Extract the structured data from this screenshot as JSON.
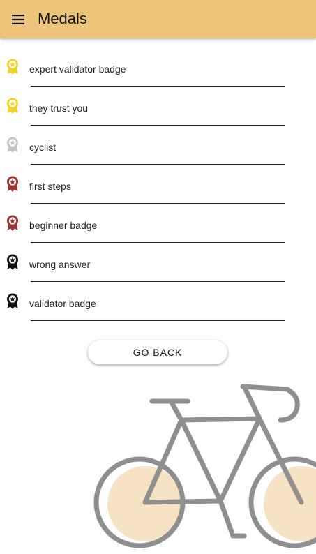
{
  "header": {
    "title": "Medals",
    "menu_icon": "hamburger-menu-icon",
    "background_color": "#ecc47a"
  },
  "medals": [
    {
      "label": "expert validator badge",
      "tier": "gold",
      "color": "#f2d024",
      "icon": "medal-icon"
    },
    {
      "label": "they trust you",
      "tier": "gold",
      "color": "#f2d024",
      "icon": "medal-icon"
    },
    {
      "label": "cyclist",
      "tier": "silver",
      "color": "#c4c4c4",
      "icon": "medal-icon"
    },
    {
      "label": "first steps",
      "tier": "bronze",
      "color": "#9e3030",
      "icon": "medal-icon"
    },
    {
      "label": "beginner badge",
      "tier": "bronze",
      "color": "#9e3030",
      "icon": "medal-icon"
    },
    {
      "label": "wrong answer",
      "tier": "none",
      "color": "#111111",
      "icon": "medal-icon"
    },
    {
      "label": "validator badge",
      "tier": "none",
      "color": "#111111",
      "icon": "medal-icon"
    }
  ],
  "actions": {
    "go_back_label": "GO BACK"
  },
  "illustration": {
    "name": "bicycle-illustration",
    "frame_color": "#8f8f8f",
    "wheel_fill_color": "#f5e3c3"
  }
}
